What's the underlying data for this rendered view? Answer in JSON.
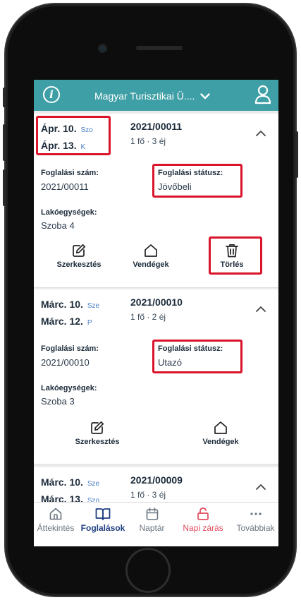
{
  "header": {
    "org_name": "Magyar Turisztikai Ü....",
    "info_icon": "info-icon",
    "user_icon": "user-icon",
    "color": "#3f9fa6"
  },
  "labels": {
    "res_number": "Foglalási szám:",
    "res_status": "Foglalási státusz:",
    "units": "Lakóegységek:"
  },
  "reservations": [
    {
      "start_date": "Ápr. 10.",
      "start_dow": "Szo",
      "end_date": "Ápr. 13.",
      "end_dow": "K",
      "number": "2021/00011",
      "summary": "1 fő · 3 éj",
      "res_number": "2021/00011",
      "status": "Jövőbeli",
      "unit": "Szoba 4",
      "actions": {
        "edit": "Szerkesztés",
        "guests": "Vendégek",
        "delete": "Törlés"
      }
    },
    {
      "start_date": "Márc. 10.",
      "start_dow": "Sze",
      "end_date": "Márc. 12.",
      "end_dow": "P",
      "number": "2021/00010",
      "summary": "1 fő · 2 éj",
      "res_number": "2021/00010",
      "status": "Utazó",
      "unit": "Szoba 3",
      "actions": {
        "edit": "Szerkesztés",
        "guests": "Vendégek"
      }
    },
    {
      "start_date": "Márc. 10.",
      "start_dow": "Sze",
      "end_date": "Márc. 13.",
      "end_dow": "Szo",
      "number": "2021/00009",
      "summary": "1 fő · 3 éj"
    }
  ],
  "nav": [
    {
      "label": "Áttekintés",
      "icon": "home-icon",
      "state": "normal"
    },
    {
      "label": "Foglalások",
      "icon": "book-icon",
      "state": "active"
    },
    {
      "label": "Naptár",
      "icon": "calendar-icon",
      "state": "normal"
    },
    {
      "label": "Napi zárás",
      "icon": "unlock-icon",
      "state": "danger"
    },
    {
      "label": "Továbbiak",
      "icon": "more-icon",
      "state": "normal"
    }
  ],
  "colors": {
    "highlight": "#d9142b",
    "active_nav": "#1f3f80",
    "danger_nav": "#e24a5d",
    "dow": "#4a7fc9"
  }
}
